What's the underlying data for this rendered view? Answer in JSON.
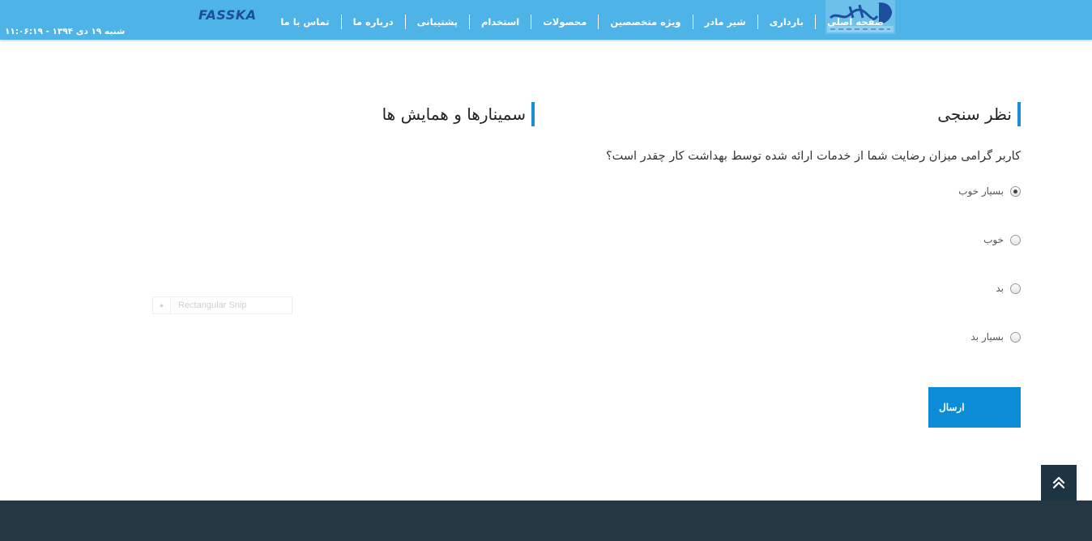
{
  "header": {
    "logo_alt": "بهداشت کار",
    "brand": "FASSKA",
    "datetime": "شنبه ۱۹ دی ۱۳۹۴ - ۱۱:۰۶:۱۹",
    "nav": [
      {
        "label": "صفحه اصلی"
      },
      {
        "label": "بارداری"
      },
      {
        "label": "شیر مادر"
      },
      {
        "label": "ویژه متخصصین"
      },
      {
        "label": "محصولات"
      },
      {
        "label": "استخدام"
      },
      {
        "label": "پشتیبانی"
      },
      {
        "label": "درباره ما"
      },
      {
        "label": "تماس با ما"
      }
    ]
  },
  "poll": {
    "title": "نظر سنجی",
    "question": "کاربر گرامی میزان رضایت شما از خدمات ارائه شده توسط بهداشت کار چقدر است؟",
    "options": [
      {
        "label": "بسیار خوب",
        "checked": true
      },
      {
        "label": "خوب",
        "checked": false
      },
      {
        "label": "بد",
        "checked": false
      },
      {
        "label": "بسیار بد",
        "checked": false
      }
    ],
    "submit_label": "ارسال"
  },
  "seminars": {
    "title": "سمینارها و همایش ها"
  },
  "overlay": {
    "snip_label": "Rectangular Snip"
  },
  "colors": {
    "header_bg": "#4eb3e6",
    "accent": "#1a8fd6",
    "button_bg": "#0c8cd6",
    "footer_bg": "#243743"
  }
}
